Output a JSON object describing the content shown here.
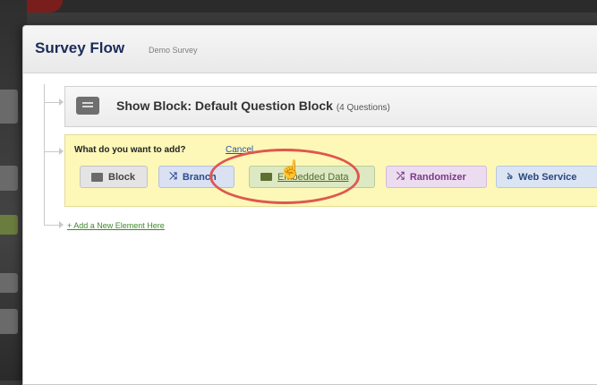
{
  "modal": {
    "title": "Survey Flow",
    "subtitle": "Demo Survey"
  },
  "block": {
    "title": "Show Block: Default Question Block",
    "count": "(4 Questions)"
  },
  "add_panel": {
    "question": "What do you want to add?",
    "cancel": "Cancel",
    "options": [
      {
        "label": "Block",
        "icon": "block-icon"
      },
      {
        "label": "Branch",
        "icon": "branch-icon"
      },
      {
        "label": "Embedded Data",
        "icon": "embedded-data-icon"
      },
      {
        "label": "Randomizer",
        "icon": "randomizer-icon"
      },
      {
        "label": "Web Service",
        "icon": "web-service-icon"
      }
    ]
  },
  "add_new": "+ Add a New Element Here",
  "colors": {
    "title": "#1b2c5a",
    "panel_bg": "#fdf8b8",
    "highlight": "#e0564f",
    "link_green": "#3f8a2a"
  }
}
